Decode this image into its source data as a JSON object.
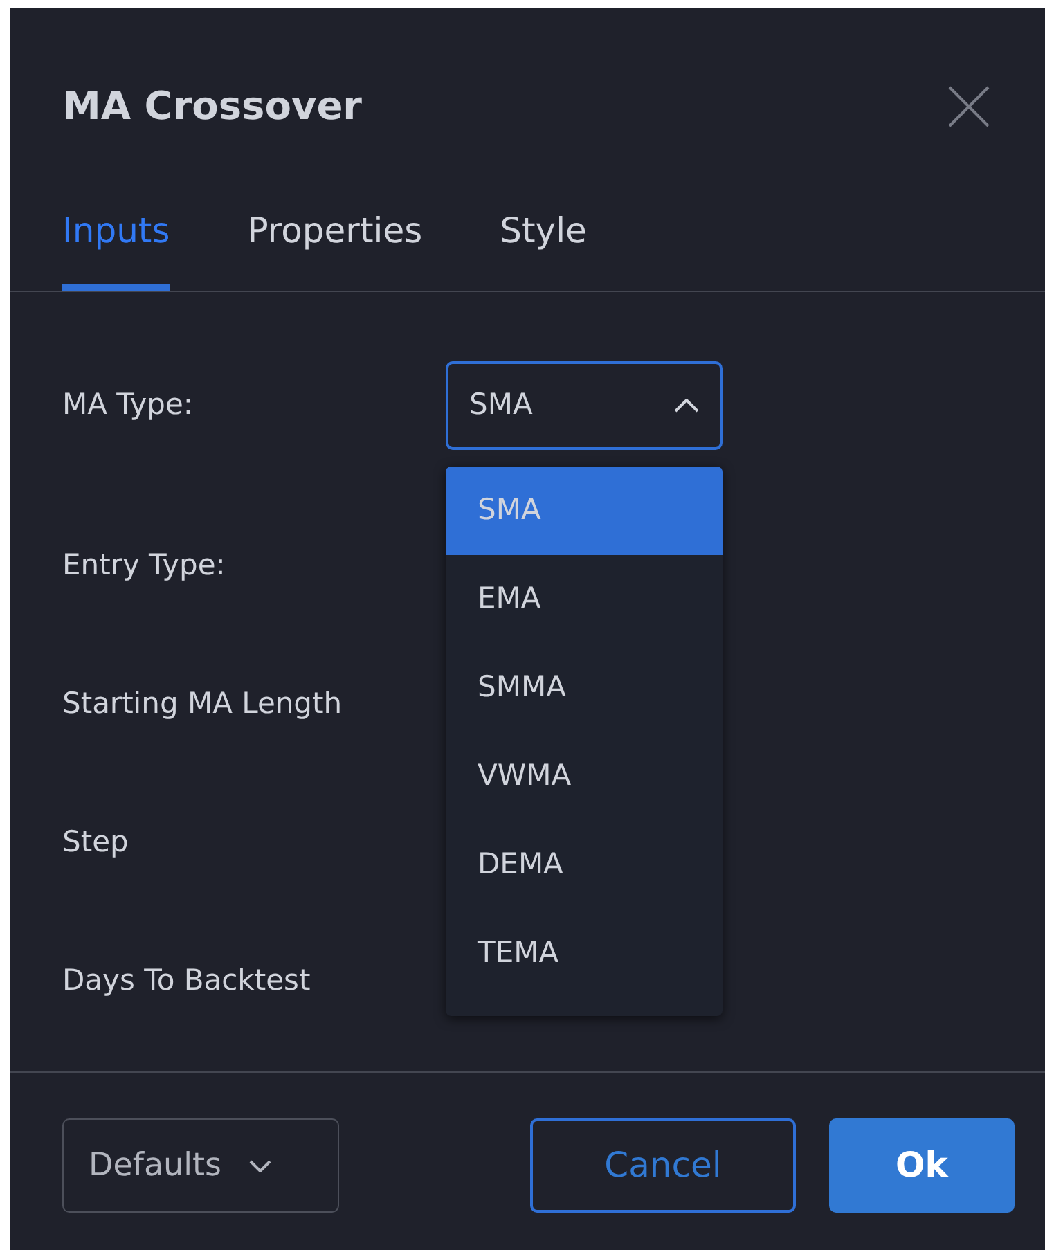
{
  "dialog": {
    "title": "MA Crossover"
  },
  "tabs": [
    {
      "label": "Inputs",
      "selected": true
    },
    {
      "label": "Properties",
      "selected": false
    },
    {
      "label": "Style",
      "selected": false
    }
  ],
  "inputs": [
    {
      "label": "MA Type:",
      "kind": "select",
      "value": "SMA",
      "expanded": true
    },
    {
      "label": "Entry Type:",
      "kind": "plain"
    },
    {
      "label": "Starting MA Length",
      "kind": "plain"
    },
    {
      "label": "Step",
      "kind": "plain"
    },
    {
      "label": "Days To Backtest",
      "kind": "plain"
    }
  ],
  "dropdown_options": [
    {
      "label": "SMA",
      "selected": true
    },
    {
      "label": "EMA",
      "selected": false
    },
    {
      "label": "SMMA",
      "selected": false
    },
    {
      "label": "VWMA",
      "selected": false
    },
    {
      "label": "DEMA",
      "selected": false
    },
    {
      "label": "TEMA",
      "selected": false
    }
  ],
  "footer": {
    "defaults": "Defaults",
    "cancel": "Cancel",
    "ok": "Ok"
  }
}
